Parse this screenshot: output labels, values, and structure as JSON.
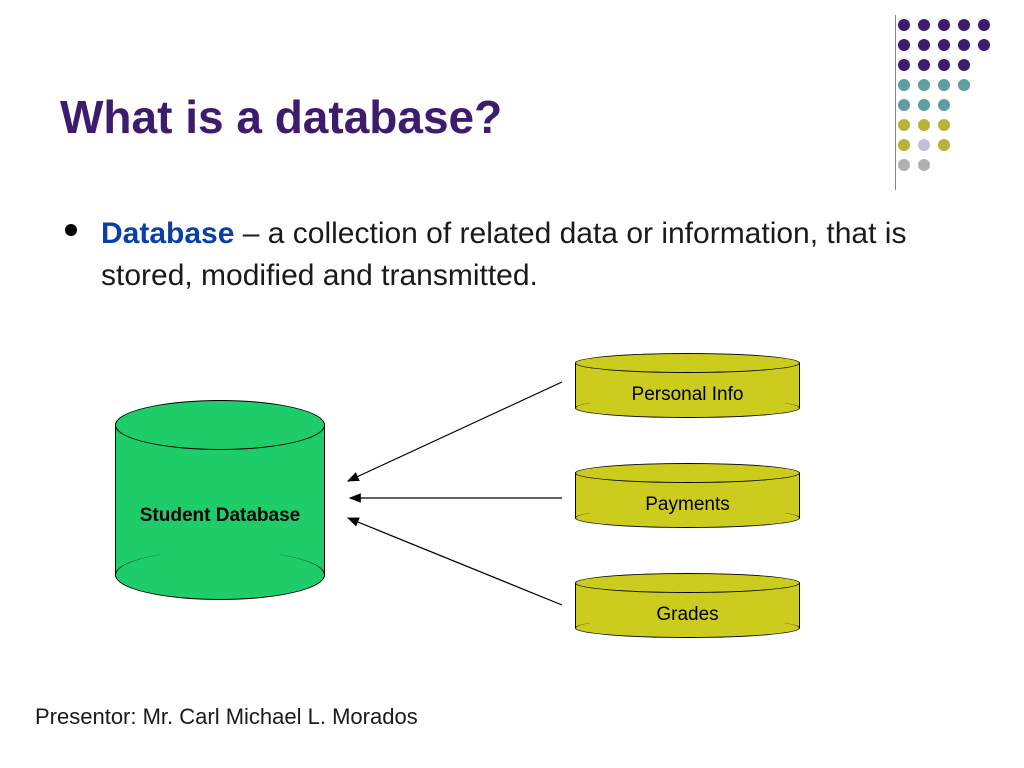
{
  "title": "What is a database?",
  "bullet": {
    "keyword": "Database",
    "text": " – a collection of related data or information, that is stored, modified and transmitted."
  },
  "main_cylinder": {
    "label": "Student Database",
    "color": "#1fcc6a"
  },
  "sub_cylinders": [
    {
      "label": "Personal Info"
    },
    {
      "label": "Payments"
    },
    {
      "label": "Grades"
    }
  ],
  "presenter_label": "Presentor:  Mr. Carl Michael L. Morados",
  "decoration": {
    "dot_colors": {
      "purple": "#3d1b6f",
      "teal": "#5f9ea0",
      "olive": "#b8b338",
      "lavender": "#c6bddb",
      "grey": "#b0b0b0"
    }
  }
}
